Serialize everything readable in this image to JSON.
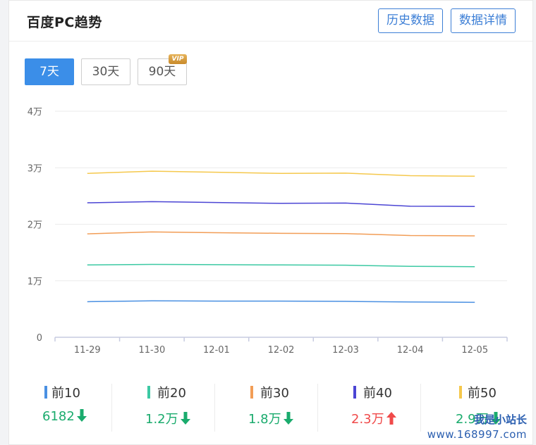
{
  "header": {
    "title": "百度PC趋势",
    "history_label": "历史数据",
    "detail_label": "数据详情"
  },
  "ranges": [
    {
      "label": "7天",
      "active": true
    },
    {
      "label": "30天",
      "active": false
    },
    {
      "label": "90天",
      "active": false,
      "badge": "VIP"
    }
  ],
  "chart_data": {
    "type": "line",
    "x": [
      "11-29",
      "11-30",
      "12-01",
      "12-02",
      "12-03",
      "12-04",
      "12-05"
    ],
    "y_ticks": [
      "0",
      "1万",
      "2万",
      "3万",
      "4万"
    ],
    "ylim": [
      0,
      40000
    ],
    "grid": true,
    "series": [
      {
        "name": "前10",
        "color": "#4a90e2",
        "values": [
          6300,
          6450,
          6400,
          6400,
          6350,
          6250,
          6182
        ]
      },
      {
        "name": "前20",
        "color": "#3cc9a3",
        "values": [
          12800,
          12900,
          12850,
          12800,
          12750,
          12550,
          12500
        ]
      },
      {
        "name": "前30",
        "color": "#f29d56",
        "values": [
          18300,
          18650,
          18500,
          18400,
          18350,
          18000,
          17950
        ]
      },
      {
        "name": "前40",
        "color": "#4b45d4",
        "values": [
          23800,
          24000,
          23850,
          23700,
          23750,
          23200,
          23150
        ]
      },
      {
        "name": "前50",
        "color": "#f5c84c",
        "values": [
          29000,
          29400,
          29200,
          29000,
          29050,
          28600,
          28500
        ]
      }
    ]
  },
  "legend": [
    {
      "name": "前10",
      "color": "#4a90e2",
      "value": "6182",
      "trend": "down"
    },
    {
      "name": "前20",
      "color": "#3cc9a3",
      "value": "1.2万",
      "trend": "down"
    },
    {
      "name": "前30",
      "color": "#f29d56",
      "value": "1.8万",
      "trend": "down"
    },
    {
      "name": "前40",
      "color": "#4b45d4",
      "value": "2.3万",
      "trend": "up"
    },
    {
      "name": "前50",
      "color": "#f5c84c",
      "value": "2.9万",
      "trend": "down"
    }
  ],
  "watermark": {
    "line1": "我是小站长",
    "line2": "www.168997.com"
  }
}
